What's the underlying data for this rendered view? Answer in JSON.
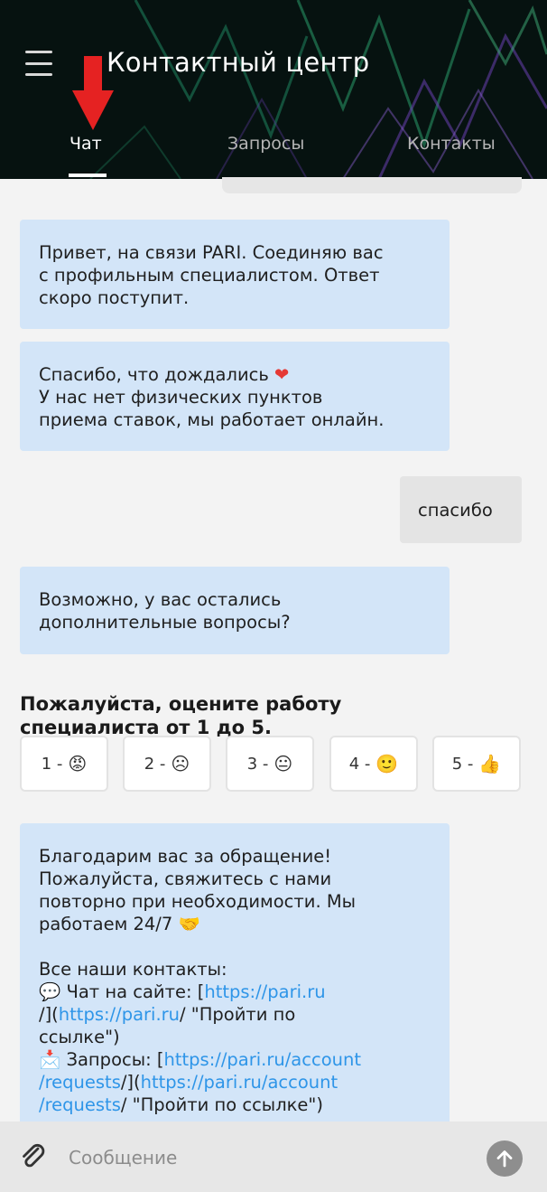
{
  "header": {
    "title": "Контактный центр",
    "tabs": [
      {
        "label": "Чат",
        "active": true
      },
      {
        "label": "Запросы",
        "active": false
      },
      {
        "label": "Контакты",
        "active": false
      }
    ]
  },
  "chat": {
    "messages": [
      {
        "from": "bot",
        "lines": [
          "Привет, на связи PARI. Соединяю вас",
          "с профильным специалистом. Ответ",
          "скоро поступит."
        ]
      },
      {
        "from": "bot",
        "lines": [
          "Спасибо, что дождались",
          "У нас нет физических пунктов",
          "приема ставок, мы работает онлайн."
        ],
        "emoji": "❤"
      },
      {
        "from": "user",
        "text": "спасибо"
      },
      {
        "from": "bot",
        "lines": [
          "Возможно, у вас остались",
          "дополнительные вопросы?"
        ]
      }
    ],
    "rating": {
      "title": "Пожалуйста, оцените работу специалиста от 1 до 5.",
      "options": [
        {
          "label": "1 -",
          "emoji": "😡"
        },
        {
          "label": "2 -",
          "emoji": "☹"
        },
        {
          "label": "3 -",
          "emoji": "😐"
        },
        {
          "label": "4 -",
          "emoji": "🙂"
        },
        {
          "label": "5 -",
          "emoji": "👍"
        }
      ]
    },
    "final_message": {
      "intro_lines": [
        "Благодарим вас за обращение!",
        "Пожалуйста, свяжитесь с нами",
        "повторно при необходимости. Мы"
      ],
      "last_intro": "работаем 24/7",
      "handshake": "🤝",
      "contacts_title": "Все наши контакты:",
      "chat_icon": "💬",
      "chat_label": "Чат на сайте: [",
      "chat_link1": "https://pari.ru",
      "chat_mid": "/](",
      "chat_link2": "https://pari.ru",
      "chat_tail": "/ \"Пройти по",
      "chat_tail2": "ссылке\")",
      "req_icon": "📩",
      "req_label": "Запросы: [",
      "req_link1a": "https://pari.ru/account",
      "req_link1b": "/requests",
      "req_mid": "/](",
      "req_link2a": "https://pari.ru/account",
      "req_link2b": "/requests",
      "req_tail": "/ \"Пройти по ссылке\")"
    }
  },
  "input": {
    "placeholder": "Сообщение"
  },
  "colors": {
    "bot_bubble": "#d3e5f8",
    "user_bubble": "#e4e4e4",
    "link": "#2e95e8",
    "header_bg": "#061210",
    "annotation_arrow": "#e52222"
  },
  "icons": {
    "menu": "hamburger-icon",
    "attach": "paperclip-icon",
    "send": "arrow-up-icon",
    "annotation": "red-arrow-icon"
  }
}
